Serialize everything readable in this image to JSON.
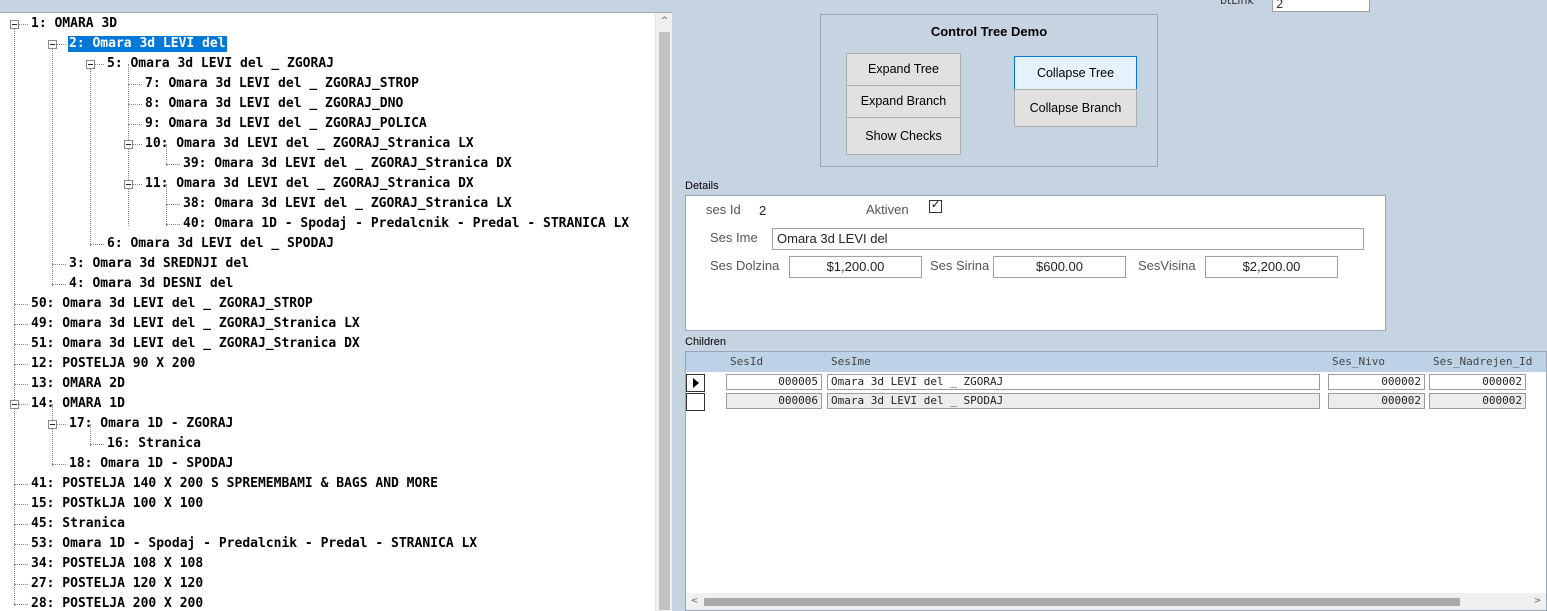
{
  "tree": {
    "nodes": [
      {
        "label": "1: OMARA 3D",
        "selected": false
      },
      {
        "label": "2: Omara 3d LEVI del",
        "selected": true
      },
      {
        "label": "5: Omara 3d LEVI del _ ZGORAJ",
        "selected": false
      },
      {
        "label": "7: Omara 3d LEVI del _ ZGORAJ_STROP",
        "selected": false
      },
      {
        "label": "8: Omara 3d LEVI del _ ZGORAJ_DNO",
        "selected": false
      },
      {
        "label": "9: Omara 3d LEVI del _ ZGORAJ_POLICA",
        "selected": false
      },
      {
        "label": "10: Omara 3d LEVI del _ ZGORAJ_Stranica LX",
        "selected": false
      },
      {
        "label": "39: Omara 3d LEVI del _ ZGORAJ_Stranica DX",
        "selected": false
      },
      {
        "label": "11: Omara 3d LEVI del _ ZGORAJ_Stranica DX",
        "selected": false
      },
      {
        "label": "38: Omara 3d LEVI del _ ZGORAJ_Stranica LX",
        "selected": false
      },
      {
        "label": "40: Omara 1D - Spodaj - Predalcnik - Predal - STRANICA LX",
        "selected": false
      },
      {
        "label": "6: Omara 3d LEVI del _ SPODAJ",
        "selected": false
      },
      {
        "label": "3: Omara 3d SREDNJI del",
        "selected": false
      },
      {
        "label": "4: Omara 3d DESNI del",
        "selected": false
      },
      {
        "label": "50: Omara 3d LEVI del _ ZGORAJ_STROP",
        "selected": false
      },
      {
        "label": "49: Omara 3d LEVI del _ ZGORAJ_Stranica LX",
        "selected": false
      },
      {
        "label": "51: Omara 3d LEVI del _ ZGORAJ_Stranica DX",
        "selected": false
      },
      {
        "label": "12: POSTELJA 90 X 200",
        "selected": false
      },
      {
        "label": "13: OMARA 2D",
        "selected": false
      },
      {
        "label": "14: OMARA 1D",
        "selected": false
      },
      {
        "label": "17: Omara 1D - ZGORAJ",
        "selected": false
      },
      {
        "label": "16: Stranica",
        "selected": false
      },
      {
        "label": "18: Omara 1D - SPODAJ",
        "selected": false
      },
      {
        "label": "41: POSTELJA 140 X 200 S SPREMEMBAMI & BAGS AND MORE",
        "selected": false
      },
      {
        "label": "15: POSTkLJA 100 X 100",
        "selected": false
      },
      {
        "label": "45: Stranica",
        "selected": false
      },
      {
        "label": "53: Omara 1D - Spodaj - Predalcnik - Predal - STRANICA LX",
        "selected": false
      },
      {
        "label": "34: POSTELJA 108 X 108",
        "selected": false
      },
      {
        "label": "27: POSTELJA 120 X 120",
        "selected": false
      },
      {
        "label": "28: POSTELJA 200 X 200",
        "selected": false
      }
    ],
    "scroll_up_glyph": "^",
    "scroll_down_glyph": "v"
  },
  "top_field": {
    "label": "btLink",
    "value": "2"
  },
  "demo": {
    "title": "Control Tree Demo",
    "expand_tree": "Expand Tree",
    "expand_branch": "Expand Branch",
    "show_checks": "Show Checks",
    "collapse_tree": "Collapse Tree",
    "collapse_branch": "Collapse Branch"
  },
  "details": {
    "caption": "Details",
    "ses_id_label": "ses Id",
    "ses_id_value": "2",
    "aktiven_label": "Aktiven",
    "aktiven_checked": true,
    "ses_ime_label": "Ses Ime",
    "ses_ime_value": "Omara 3d LEVI del",
    "dolzina_label": "Ses Dolzina",
    "dolzina_value": "$1,200.00",
    "sirina_label": "Ses Sirina",
    "sirina_value": "$600.00",
    "visina_label": "SesVisina",
    "visina_value": "$2,200.00"
  },
  "children": {
    "caption": "Children",
    "columns": [
      "SesId",
      "SesIme",
      "Ses_Nivo",
      "Ses_Nadrejen_Id"
    ],
    "rows": [
      {
        "current": true,
        "ses_id": "000005",
        "ses_ime": "Omara 3d LEVI del _ ZGORAJ",
        "ses_nivo": "000002",
        "ses_nadrejen_id": "000002"
      },
      {
        "current": false,
        "ses_id": "000006",
        "ses_ime": "Omara 3d LEVI del _ SPODAJ",
        "ses_nivo": "000002",
        "ses_nadrejen_id": "000002"
      }
    ],
    "scroll_left_glyph": "<",
    "scroll_right_glyph": ">"
  },
  "colors": {
    "form_background": "#c6d3e1",
    "selection": "#0078d7",
    "grid_header": "#bcd2e6"
  }
}
